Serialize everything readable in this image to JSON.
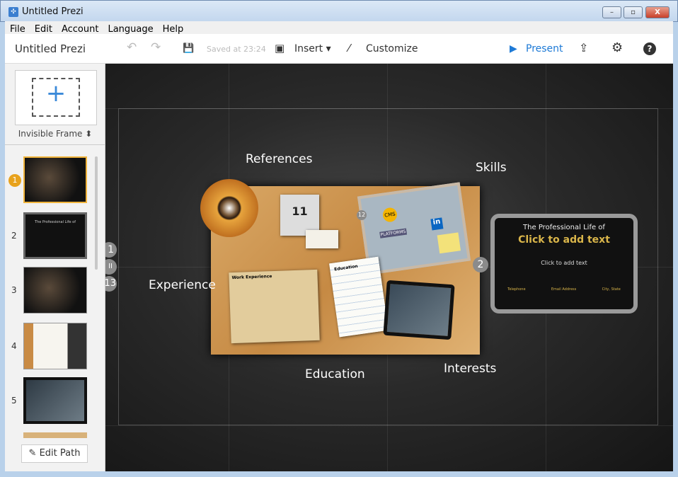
{
  "window": {
    "title": "Untitled Prezi",
    "minimize": "–",
    "maximize": "▫",
    "close": "X"
  },
  "menu": [
    "File",
    "Edit",
    "Account",
    "Language",
    "Help"
  ],
  "toolbar": {
    "doc_title": "Untitled Prezi",
    "undo": "↶",
    "redo": "↷",
    "save_icon": "💾",
    "saved": "Saved at 23:24",
    "insert": "Insert ▾",
    "customize": "Customize",
    "present": "Present",
    "share_icon": "⇪",
    "settings_icon": "⚙",
    "help_icon": "?"
  },
  "accent": "#1e7ad6",
  "sidebar": {
    "add_icon": "+",
    "frame_type": "Invisible Frame ⬍",
    "slides": [
      "1",
      "2",
      "3",
      "4",
      "5"
    ],
    "slide2_caption": "The Professional Life of",
    "edit_path": "Edit Path"
  },
  "canvas": {
    "labels": {
      "references": "References",
      "skills": "Skills",
      "experience": "Experience",
      "education": "Education",
      "interests": "Interests"
    },
    "path_badges": [
      "1",
      "II",
      "13"
    ],
    "step_badge": "2",
    "step_12": "12",
    "calendar_day": "11",
    "work_experience": "Work Experience",
    "education_paper": "Education",
    "cms": "CMS",
    "platforms": "PLATFORMS",
    "linkedin": "in",
    "slide2": {
      "subtitle": "The Professional Life of",
      "title": "Click to add text",
      "body": "Click to add text",
      "footer": [
        "Telephone",
        "Email Address",
        "City, State"
      ]
    }
  }
}
